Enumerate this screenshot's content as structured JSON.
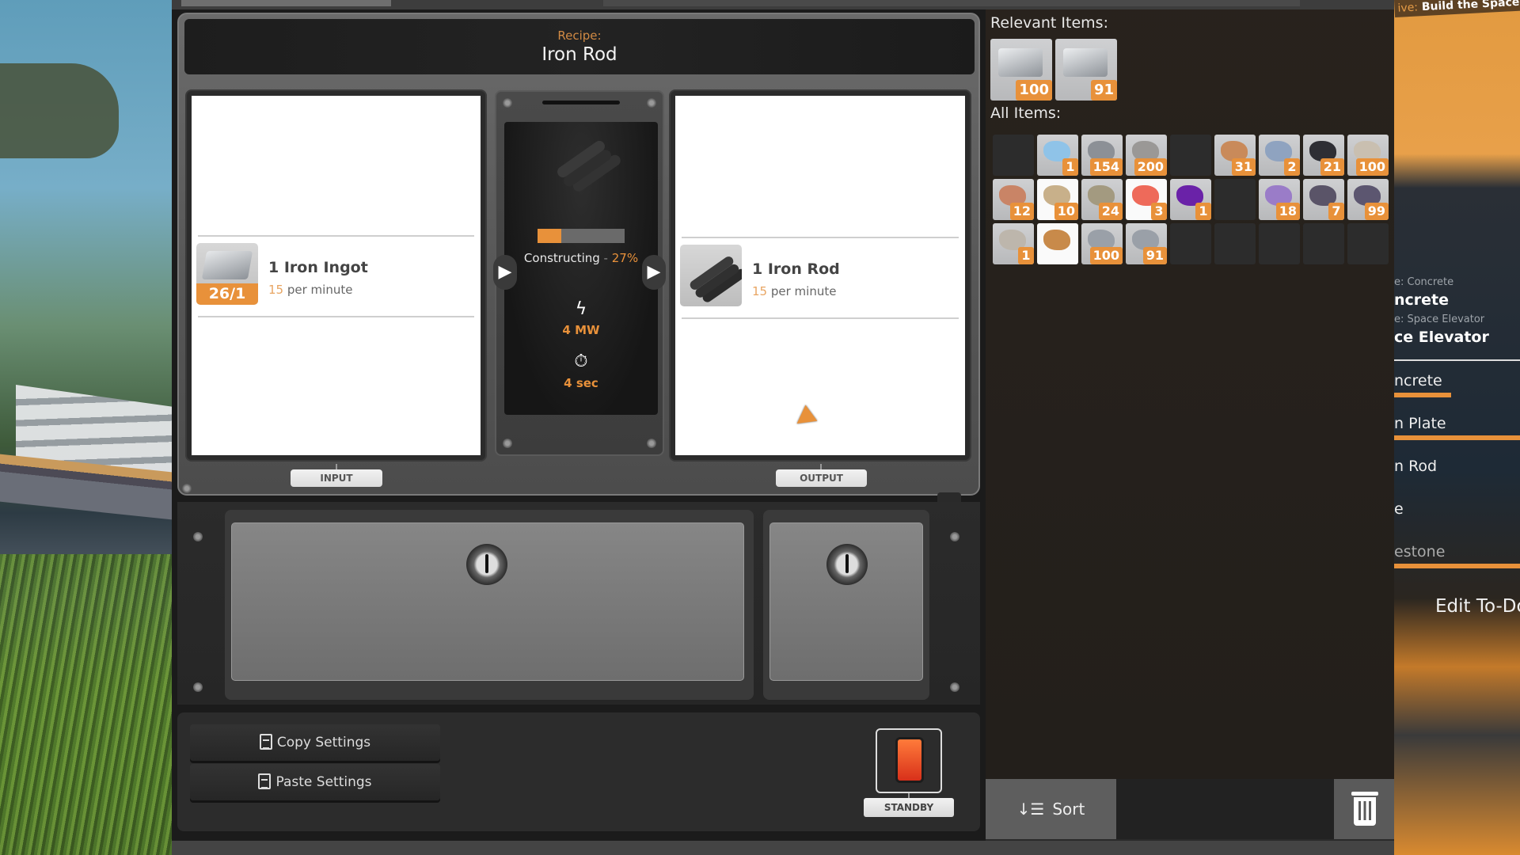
{
  "recipe": {
    "label": "Recipe:",
    "name": "Iron Rod"
  },
  "input": {
    "tag": "INPUT",
    "item": {
      "name": "1 Iron Ingot",
      "rate_value": "15",
      "rate_unit": "per minute",
      "slot_count": "26/1",
      "icon": "iron-ingot-icon"
    }
  },
  "output": {
    "tag": "OUTPUT",
    "item": {
      "name": "1 Iron Rod",
      "rate_value": "15",
      "rate_unit": "per minute",
      "icon": "iron-rod-icon"
    }
  },
  "production": {
    "status": "Constructing",
    "separator": " - ",
    "percent_label": "27%",
    "progress": 0.27,
    "power": "4 MW",
    "cycle_time": "4 sec"
  },
  "controls": {
    "copy_label": "Copy Settings",
    "paste_label": "Paste Settings",
    "standby_label": "STANDBY"
  },
  "inventory": {
    "relevant_heading": "Relevant Items:",
    "all_heading": "All Items:",
    "relevant_items": [
      {
        "icon": "iron-ingot-icon",
        "count": "100"
      },
      {
        "icon": "iron-ingot-icon",
        "count": "91"
      }
    ],
    "all_items": [
      {
        "icon": "",
        "count": ""
      },
      {
        "icon": "quartz-crystal-icon",
        "count": "1",
        "color": "#8fc3e8"
      },
      {
        "icon": "iron-plate-icon",
        "count": "154",
        "color": "#8c9096"
      },
      {
        "icon": "concrete-icon",
        "count": "200",
        "color": "#9a9896"
      },
      {
        "icon": "",
        "count": ""
      },
      {
        "icon": "wire-spool-icon",
        "count": "31",
        "color": "#c98a5a"
      },
      {
        "icon": "iron-sheet-icon",
        "count": "2",
        "color": "#8fa3c0"
      },
      {
        "icon": "cable-icon",
        "count": "21",
        "color": "#2e2e34"
      },
      {
        "icon": "limestone-icon",
        "count": "100",
        "color": "#c9bfb0"
      },
      {
        "icon": "copper-ore-icon",
        "count": "12",
        "color": "#c98466"
      },
      {
        "icon": "mushroom-icon",
        "count": "10",
        "color": "#c8b08a",
        "white": true
      },
      {
        "icon": "copper-sheet-icon",
        "count": "24",
        "color": "#a39a80"
      },
      {
        "icon": "berry-icon",
        "count": "3",
        "color": "#ee6a5a",
        "white": true
      },
      {
        "icon": "power-slug-icon",
        "count": "1",
        "color": "#6a22a8"
      },
      {
        "icon": "",
        "count": ""
      },
      {
        "icon": "caterium-ore-icon",
        "count": "18",
        "color": "#9a7cc8"
      },
      {
        "icon": "iron-ore-icon",
        "count": "7",
        "color": "#5a5468"
      },
      {
        "icon": "iron-ore-icon",
        "count": "99",
        "color": "#5c5670"
      },
      {
        "icon": "stone-icon",
        "count": "1",
        "color": "#bdb6ac"
      },
      {
        "icon": "xeno-zapper-icon",
        "count": "",
        "color": "#c88a4a",
        "white": true
      },
      {
        "icon": "iron-ingot-icon",
        "count": "100",
        "color": "#9aa0a8"
      },
      {
        "icon": "iron-ingot-icon",
        "count": "91",
        "color": "#9aa0a8"
      },
      {
        "icon": "",
        "count": ""
      },
      {
        "icon": "",
        "count": ""
      },
      {
        "icon": "",
        "count": ""
      },
      {
        "icon": "",
        "count": ""
      },
      {
        "icon": "",
        "count": ""
      }
    ],
    "sort_label": "Sort"
  },
  "hud": {
    "objective_prefix": "ive:",
    "objective_text": "Build the Space",
    "todo": [
      {
        "sub": "e: Concrete",
        "main": "ncrete"
      },
      {
        "sub": "e: Space Elevator",
        "main": "ce Elevator"
      }
    ],
    "todo_items": [
      {
        "label": "ncrete",
        "progress": 0.45
      },
      {
        "label": "n Plate",
        "progress": 1.0
      },
      {
        "label": "n Rod",
        "progress": 0
      },
      {
        "label": "e",
        "progress": 0
      },
      {
        "label": "estone",
        "progress": 1.0,
        "dim": true
      }
    ],
    "edit_todo_label": "Edit To-Do"
  },
  "colors": {
    "accent": "#e8913a",
    "panel": "#2c2c2c",
    "card": "#ffffff"
  }
}
